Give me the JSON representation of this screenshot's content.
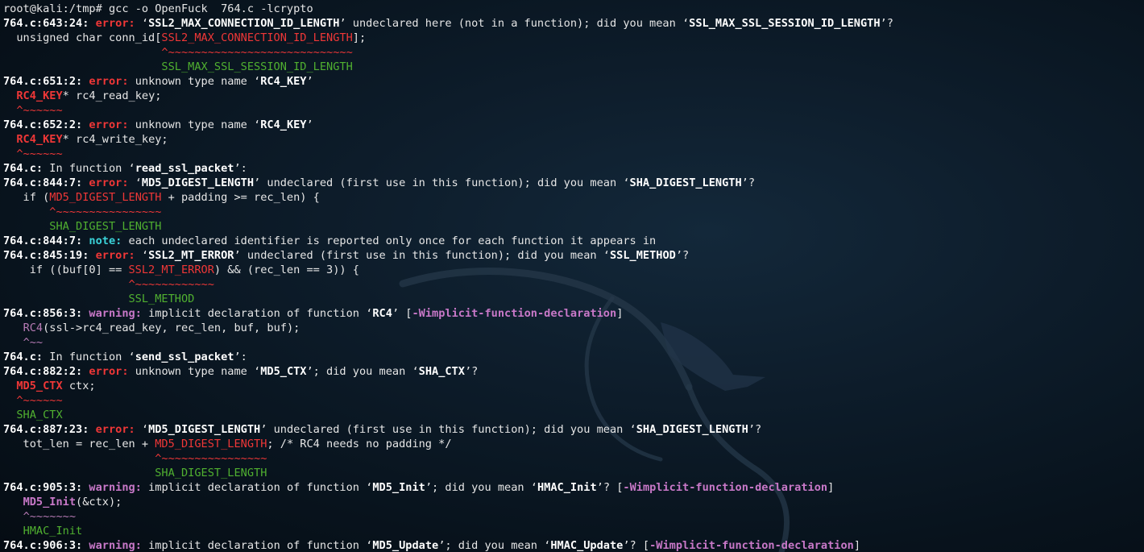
{
  "prompt": {
    "text": "root@kali:/tmp# ",
    "command": "gcc -o OpenFuck  764.c -lcrypto"
  },
  "lines": [
    [
      {
        "t": "764.c:643:24: ",
        "s": "b"
      },
      {
        "t": "error: ",
        "s": "err"
      },
      {
        "t": "‘",
        "s": "plain"
      },
      {
        "t": "SSL2_MAX_CONNECTION_ID_LENGTH",
        "s": "b"
      },
      {
        "t": "’ undeclared here (not in a function); did you mean ‘",
        "s": "plain"
      },
      {
        "t": "SSL_MAX_SSL_SESSION_ID_LENGTH",
        "s": "b"
      },
      {
        "t": "’?",
        "s": "plain"
      }
    ],
    [
      {
        "t": "  unsigned char conn_id[",
        "s": "plain"
      },
      {
        "t": "SSL2_MAX_CONNECTION_ID_LENGTH",
        "s": "errp"
      },
      {
        "t": "];",
        "s": "plain"
      }
    ],
    [
      {
        "t": "                        ",
        "s": "plain"
      },
      {
        "t": "^~~~~~~~~~~~~~~~~~~~~~~~~~~~~",
        "s": "errp"
      }
    ],
    [
      {
        "t": "                        ",
        "s": "plain"
      },
      {
        "t": "SSL_MAX_SSL_SESSION_ID_LENGTH",
        "s": "fix"
      }
    ],
    [
      {
        "t": "764.c:651:2: ",
        "s": "b"
      },
      {
        "t": "error: ",
        "s": "err"
      },
      {
        "t": "unknown type name ‘",
        "s": "plain"
      },
      {
        "t": "RC4_KEY",
        "s": "b"
      },
      {
        "t": "’",
        "s": "plain"
      }
    ],
    [
      {
        "t": "  ",
        "s": "plain"
      },
      {
        "t": "RC4_KEY",
        "s": "err"
      },
      {
        "t": "* rc4_read_key;",
        "s": "plain"
      }
    ],
    [
      {
        "t": "  ",
        "s": "plain"
      },
      {
        "t": "^~~~~~~",
        "s": "errp"
      }
    ],
    [
      {
        "t": "764.c:652:2: ",
        "s": "b"
      },
      {
        "t": "error: ",
        "s": "err"
      },
      {
        "t": "unknown type name ‘",
        "s": "plain"
      },
      {
        "t": "RC4_KEY",
        "s": "b"
      },
      {
        "t": "’",
        "s": "plain"
      }
    ],
    [
      {
        "t": "  ",
        "s": "plain"
      },
      {
        "t": "RC4_KEY",
        "s": "err"
      },
      {
        "t": "* rc4_write_key;",
        "s": "plain"
      }
    ],
    [
      {
        "t": "  ",
        "s": "plain"
      },
      {
        "t": "^~~~~~~",
        "s": "errp"
      }
    ],
    [
      {
        "t": "764.c:",
        "s": "b"
      },
      {
        "t": " In function ‘",
        "s": "plain"
      },
      {
        "t": "read_ssl_packet",
        "s": "b"
      },
      {
        "t": "’:",
        "s": "plain"
      }
    ],
    [
      {
        "t": "764.c:844:7: ",
        "s": "b"
      },
      {
        "t": "error: ",
        "s": "err"
      },
      {
        "t": "‘",
        "s": "plain"
      },
      {
        "t": "MD5_DIGEST_LENGTH",
        "s": "b"
      },
      {
        "t": "’ undeclared (first use in this function); did you mean ‘",
        "s": "plain"
      },
      {
        "t": "SHA_DIGEST_LENGTH",
        "s": "b"
      },
      {
        "t": "’?",
        "s": "plain"
      }
    ],
    [
      {
        "t": "   if (",
        "s": "plain"
      },
      {
        "t": "MD5_DIGEST_LENGTH",
        "s": "errp"
      },
      {
        "t": " + padding >= rec_len) {",
        "s": "plain"
      }
    ],
    [
      {
        "t": "       ",
        "s": "plain"
      },
      {
        "t": "^~~~~~~~~~~~~~~~~",
        "s": "errp"
      }
    ],
    [
      {
        "t": "       ",
        "s": "plain"
      },
      {
        "t": "SHA_DIGEST_LENGTH",
        "s": "fix"
      }
    ],
    [
      {
        "t": "764.c:844:7: ",
        "s": "b"
      },
      {
        "t": "note: ",
        "s": "note"
      },
      {
        "t": "each undeclared identifier is reported only once for each function it appears in",
        "s": "plain"
      }
    ],
    [
      {
        "t": "764.c:845:19: ",
        "s": "b"
      },
      {
        "t": "error: ",
        "s": "err"
      },
      {
        "t": "‘",
        "s": "plain"
      },
      {
        "t": "SSL2_MT_ERROR",
        "s": "b"
      },
      {
        "t": "’ undeclared (first use in this function); did you mean ‘",
        "s": "plain"
      },
      {
        "t": "SSL_METHOD",
        "s": "b"
      },
      {
        "t": "’?",
        "s": "plain"
      }
    ],
    [
      {
        "t": "    if ((buf[0] == ",
        "s": "plain"
      },
      {
        "t": "SSL2_MT_ERROR",
        "s": "errp"
      },
      {
        "t": ") && (rec_len == 3)) {",
        "s": "plain"
      }
    ],
    [
      {
        "t": "                   ",
        "s": "plain"
      },
      {
        "t": "^~~~~~~~~~~~~",
        "s": "errp"
      }
    ],
    [
      {
        "t": "                   ",
        "s": "plain"
      },
      {
        "t": "SSL_METHOD",
        "s": "fix"
      }
    ],
    [
      {
        "t": "764.c:856:3: ",
        "s": "b"
      },
      {
        "t": "warning: ",
        "s": "warn"
      },
      {
        "t": "implicit declaration of function ‘",
        "s": "plain"
      },
      {
        "t": "RC4",
        "s": "b"
      },
      {
        "t": "’ [",
        "s": "plain"
      },
      {
        "t": "-Wimplicit-function-declaration",
        "s": "warn"
      },
      {
        "t": "]",
        "s": "plain"
      }
    ],
    [
      {
        "t": "   ",
        "s": "plain"
      },
      {
        "t": "RC4",
        "s": "warnp"
      },
      {
        "t": "(ssl->rc4_read_key, rec_len, buf, buf);",
        "s": "plain"
      }
    ],
    [
      {
        "t": "   ",
        "s": "plain"
      },
      {
        "t": "^~~",
        "s": "warnp"
      }
    ],
    [
      {
        "t": "764.c:",
        "s": "b"
      },
      {
        "t": " In function ‘",
        "s": "plain"
      },
      {
        "t": "send_ssl_packet",
        "s": "b"
      },
      {
        "t": "’:",
        "s": "plain"
      }
    ],
    [
      {
        "t": "764.c:882:2: ",
        "s": "b"
      },
      {
        "t": "error: ",
        "s": "err"
      },
      {
        "t": "unknown type name ‘",
        "s": "plain"
      },
      {
        "t": "MD5_CTX",
        "s": "b"
      },
      {
        "t": "’; did you mean ‘",
        "s": "plain"
      },
      {
        "t": "SHA_CTX",
        "s": "b"
      },
      {
        "t": "’?",
        "s": "plain"
      }
    ],
    [
      {
        "t": "  ",
        "s": "plain"
      },
      {
        "t": "MD5_CTX",
        "s": "err"
      },
      {
        "t": " ctx;",
        "s": "plain"
      }
    ],
    [
      {
        "t": "  ",
        "s": "plain"
      },
      {
        "t": "^~~~~~~",
        "s": "errp"
      }
    ],
    [
      {
        "t": "  ",
        "s": "plain"
      },
      {
        "t": "SHA_CTX",
        "s": "fix"
      }
    ],
    [
      {
        "t": "764.c:887:23: ",
        "s": "b"
      },
      {
        "t": "error: ",
        "s": "err"
      },
      {
        "t": "‘",
        "s": "plain"
      },
      {
        "t": "MD5_DIGEST_LENGTH",
        "s": "b"
      },
      {
        "t": "’ undeclared (first use in this function); did you mean ‘",
        "s": "plain"
      },
      {
        "t": "SHA_DIGEST_LENGTH",
        "s": "b"
      },
      {
        "t": "’?",
        "s": "plain"
      }
    ],
    [
      {
        "t": "   tot_len = rec_len + ",
        "s": "plain"
      },
      {
        "t": "MD5_DIGEST_LENGTH",
        "s": "errp"
      },
      {
        "t": "; /* RC4 needs no padding */",
        "s": "plain"
      }
    ],
    [
      {
        "t": "                       ",
        "s": "plain"
      },
      {
        "t": "^~~~~~~~~~~~~~~~~",
        "s": "errp"
      }
    ],
    [
      {
        "t": "                       ",
        "s": "plain"
      },
      {
        "t": "SHA_DIGEST_LENGTH",
        "s": "fix"
      }
    ],
    [
      {
        "t": "764.c:905:3: ",
        "s": "b"
      },
      {
        "t": "warning: ",
        "s": "warn"
      },
      {
        "t": "implicit declaration of function ‘",
        "s": "plain"
      },
      {
        "t": "MD5_Init",
        "s": "b"
      },
      {
        "t": "’; did you mean ‘",
        "s": "plain"
      },
      {
        "t": "HMAC_Init",
        "s": "b"
      },
      {
        "t": "’? [",
        "s": "plain"
      },
      {
        "t": "-Wimplicit-function-declaration",
        "s": "warn"
      },
      {
        "t": "]",
        "s": "plain"
      }
    ],
    [
      {
        "t": "   ",
        "s": "plain"
      },
      {
        "t": "MD5_Init",
        "s": "warn"
      },
      {
        "t": "(&ctx);",
        "s": "plain"
      }
    ],
    [
      {
        "t": "   ",
        "s": "plain"
      },
      {
        "t": "^~~~~~~~",
        "s": "warnp"
      }
    ],
    [
      {
        "t": "   ",
        "s": "plain"
      },
      {
        "t": "HMAC_Init",
        "s": "fix"
      }
    ],
    [
      {
        "t": "764.c:906:3: ",
        "s": "b"
      },
      {
        "t": "warning: ",
        "s": "warn"
      },
      {
        "t": "implicit declaration of function ‘",
        "s": "plain"
      },
      {
        "t": "MD5_Update",
        "s": "b"
      },
      {
        "t": "’; did you mean ‘",
        "s": "plain"
      },
      {
        "t": "HMAC_Update",
        "s": "b"
      },
      {
        "t": "’? [",
        "s": "plain"
      },
      {
        "t": "-Wimplicit-function-declaration",
        "s": "warn"
      },
      {
        "t": "]",
        "s": "plain"
      }
    ]
  ]
}
